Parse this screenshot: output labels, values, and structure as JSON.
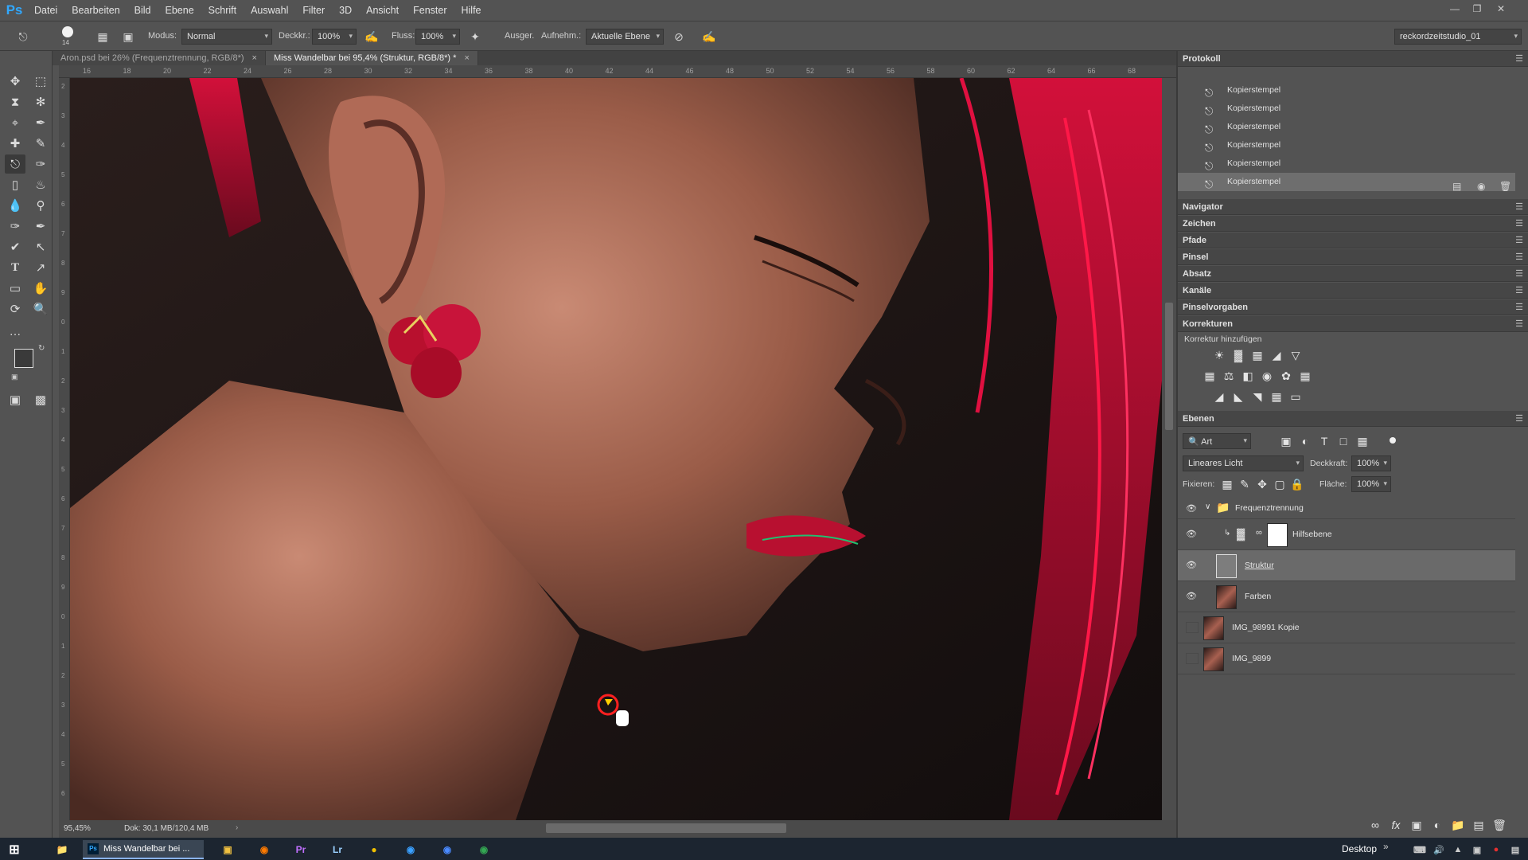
{
  "menubar": {
    "logo": "Ps",
    "items": [
      "Datei",
      "Bearbeiten",
      "Bild",
      "Ebene",
      "Schrift",
      "Auswahl",
      "Filter",
      "3D",
      "Ansicht",
      "Fenster",
      "Hilfe"
    ]
  },
  "options": {
    "brush_size": "14",
    "mode_label": "Modus:",
    "mode_value": "Normal",
    "opacity_label": "Deckkr.:",
    "opacity_value": "100%",
    "flow_label": "Fluss:",
    "flow_value": "100%",
    "aligned_label": "Ausger.",
    "aligned_checked": true,
    "sample_label": "Aufnehm.:",
    "sample_value": "Aktuelle Ebene",
    "workspace": "reckordzeitstudio_01"
  },
  "tabs": [
    {
      "label": "Aron.psd bei 26% (Frequenztrennung, RGB/8*)",
      "active": false
    },
    {
      "label": "Miss Wandelbar bei 95,4% (Struktur, RGB/8*) *",
      "active": true
    }
  ],
  "ruler_top": [
    "16",
    "18",
    "20",
    "22",
    "24",
    "26",
    "28",
    "30",
    "32",
    "34",
    "36",
    "38",
    "40",
    "42",
    "44",
    "46",
    "48",
    "50",
    "52",
    "54",
    "56",
    "58",
    "60",
    "62",
    "64",
    "66",
    "68"
  ],
  "ruler_left": [
    "2",
    "3",
    "4",
    "5",
    "6",
    "7",
    "8",
    "9",
    "0",
    "1",
    "2",
    "3",
    "4",
    "5",
    "6",
    "7",
    "8",
    "9",
    "0",
    "1",
    "2",
    "3",
    "4",
    "5",
    "6"
  ],
  "status": {
    "zoom": "95,45%",
    "doc": "Dok: 30,1 MB/120,4 MB"
  },
  "panels": {
    "protokoll": {
      "title": "Protokoll",
      "items": [
        "Kopierstempel",
        "Kopierstempel",
        "Kopierstempel",
        "Kopierstempel",
        "Kopierstempel",
        "Kopierstempel"
      ],
      "selected_index": 5
    },
    "collapsed": [
      "Navigator",
      "Zeichen",
      "Pfade",
      "Pinsel",
      "Absatz",
      "Kanäle",
      "Pinselvorgaben"
    ],
    "korrekturen": {
      "title": "Korrekturen",
      "subtitle": "Korrektur hinzufügen"
    },
    "ebenen": {
      "title": "Ebenen",
      "filter_value": "Art",
      "blend_mode": "Lineares Licht",
      "opacity_label": "Deckkraft:",
      "opacity_value": "100%",
      "lock_label": "Fixieren:",
      "fill_label": "Fläche:",
      "fill_value": "100%",
      "layers": [
        {
          "name": "Frequenztrennung",
          "type": "group",
          "visible": true
        },
        {
          "name": "Hilfsebene",
          "type": "adjustment",
          "visible": true
        },
        {
          "name": "Struktur",
          "type": "pixel",
          "visible": true,
          "selected": true
        },
        {
          "name": "Farben",
          "type": "pixel",
          "visible": true
        },
        {
          "name": "IMG_98991 Kopie",
          "type": "pixel",
          "visible": false
        },
        {
          "name": "IMG_9899",
          "type": "pixel",
          "visible": false
        }
      ]
    }
  },
  "taskbar": {
    "active_app": "Miss Wandelbar bei ...",
    "desktop_label": "Desktop"
  },
  "colors": {
    "ui_bg": "#535353",
    "panel_header": "#464646",
    "ps_blue": "#31a8ff",
    "foreground_swatch": "#3a3a3a",
    "background_swatch": "#e8b4a8"
  }
}
